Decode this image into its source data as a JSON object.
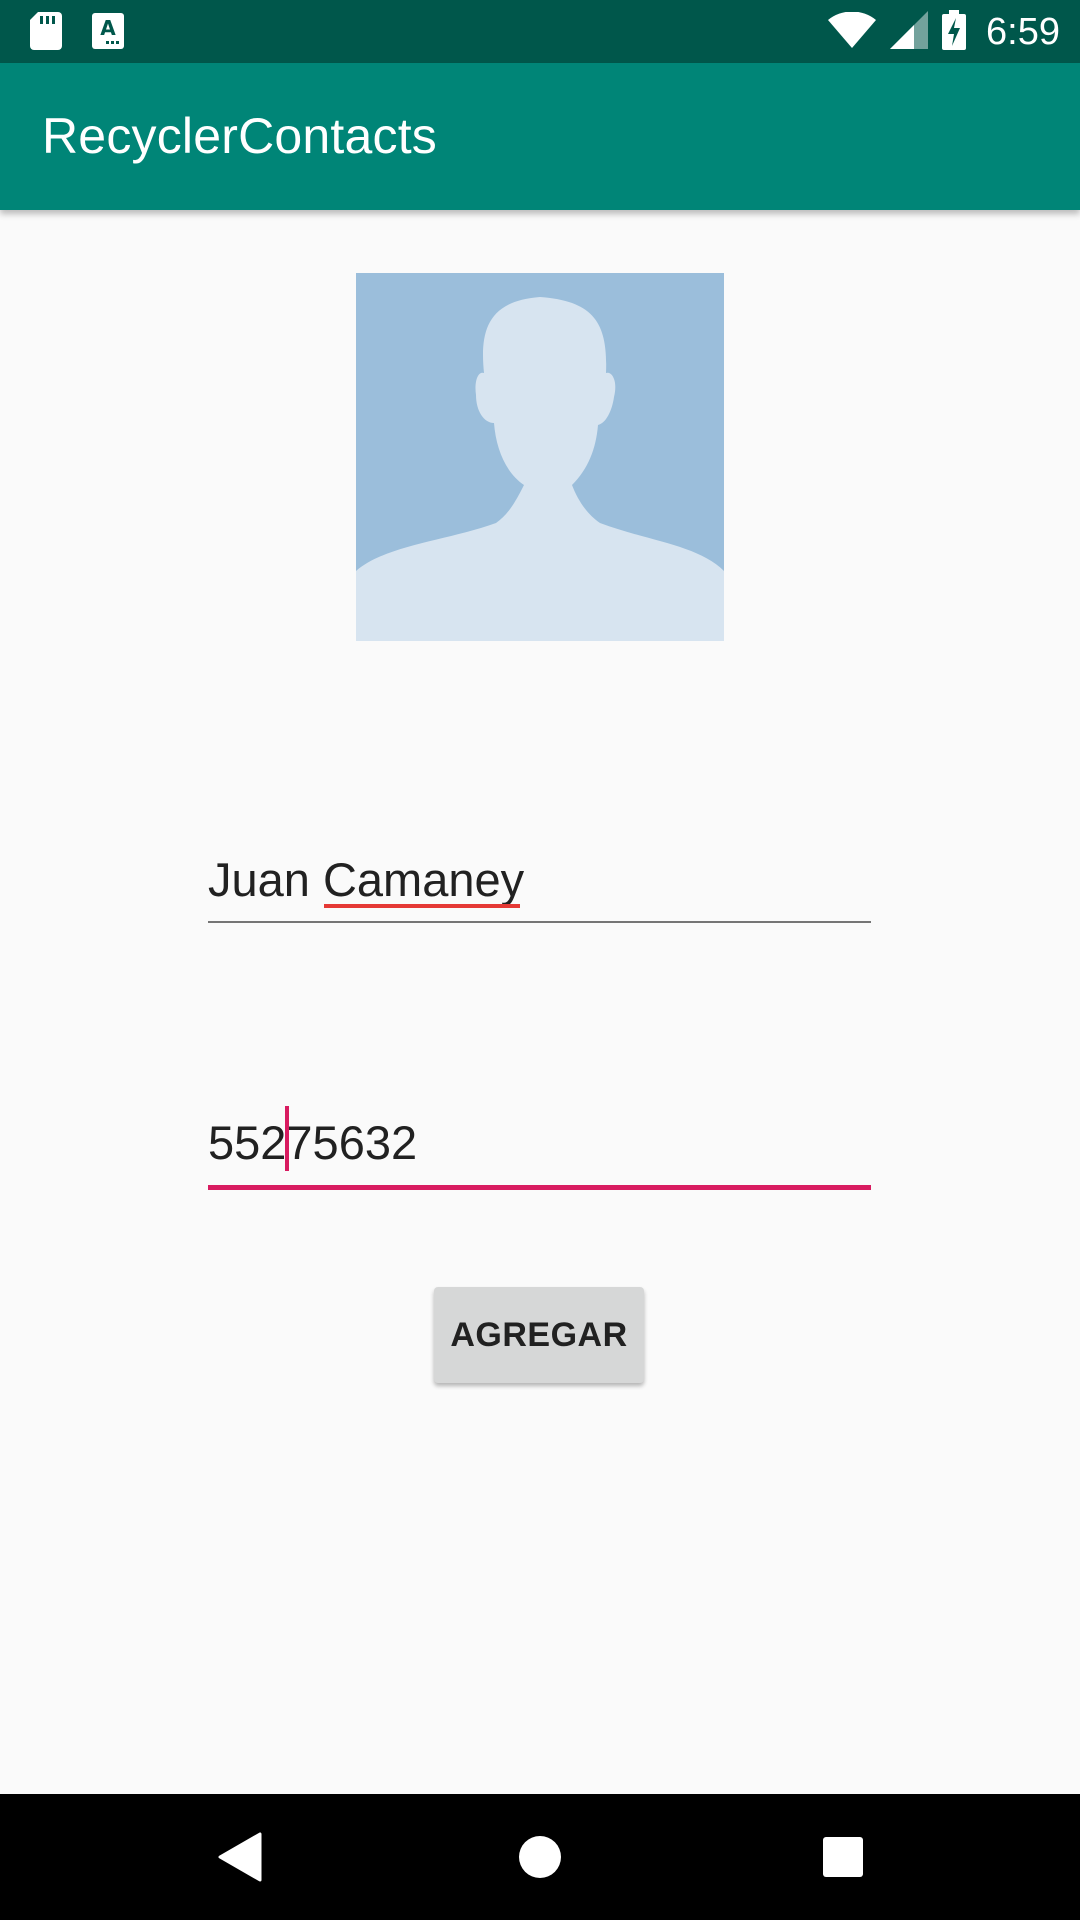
{
  "status_bar": {
    "time": "6:59",
    "icons": [
      "sd-card-icon",
      "keyboard-a-icon",
      "wifi-icon",
      "cell-signal-icon",
      "battery-charging-icon"
    ],
    "color": "#00574b"
  },
  "app_bar": {
    "title": "RecyclerContacts",
    "color": "#008577"
  },
  "avatar": {
    "icon": "person-placeholder-icon",
    "background": "#9bbedb"
  },
  "form": {
    "name_value": "Juan Camaney",
    "phone_value": "55275632",
    "accent": "#d81b60",
    "button_label": "AGREGAR"
  },
  "nav_bar": {
    "icons": [
      "back-icon",
      "home-icon",
      "recents-icon"
    ]
  }
}
